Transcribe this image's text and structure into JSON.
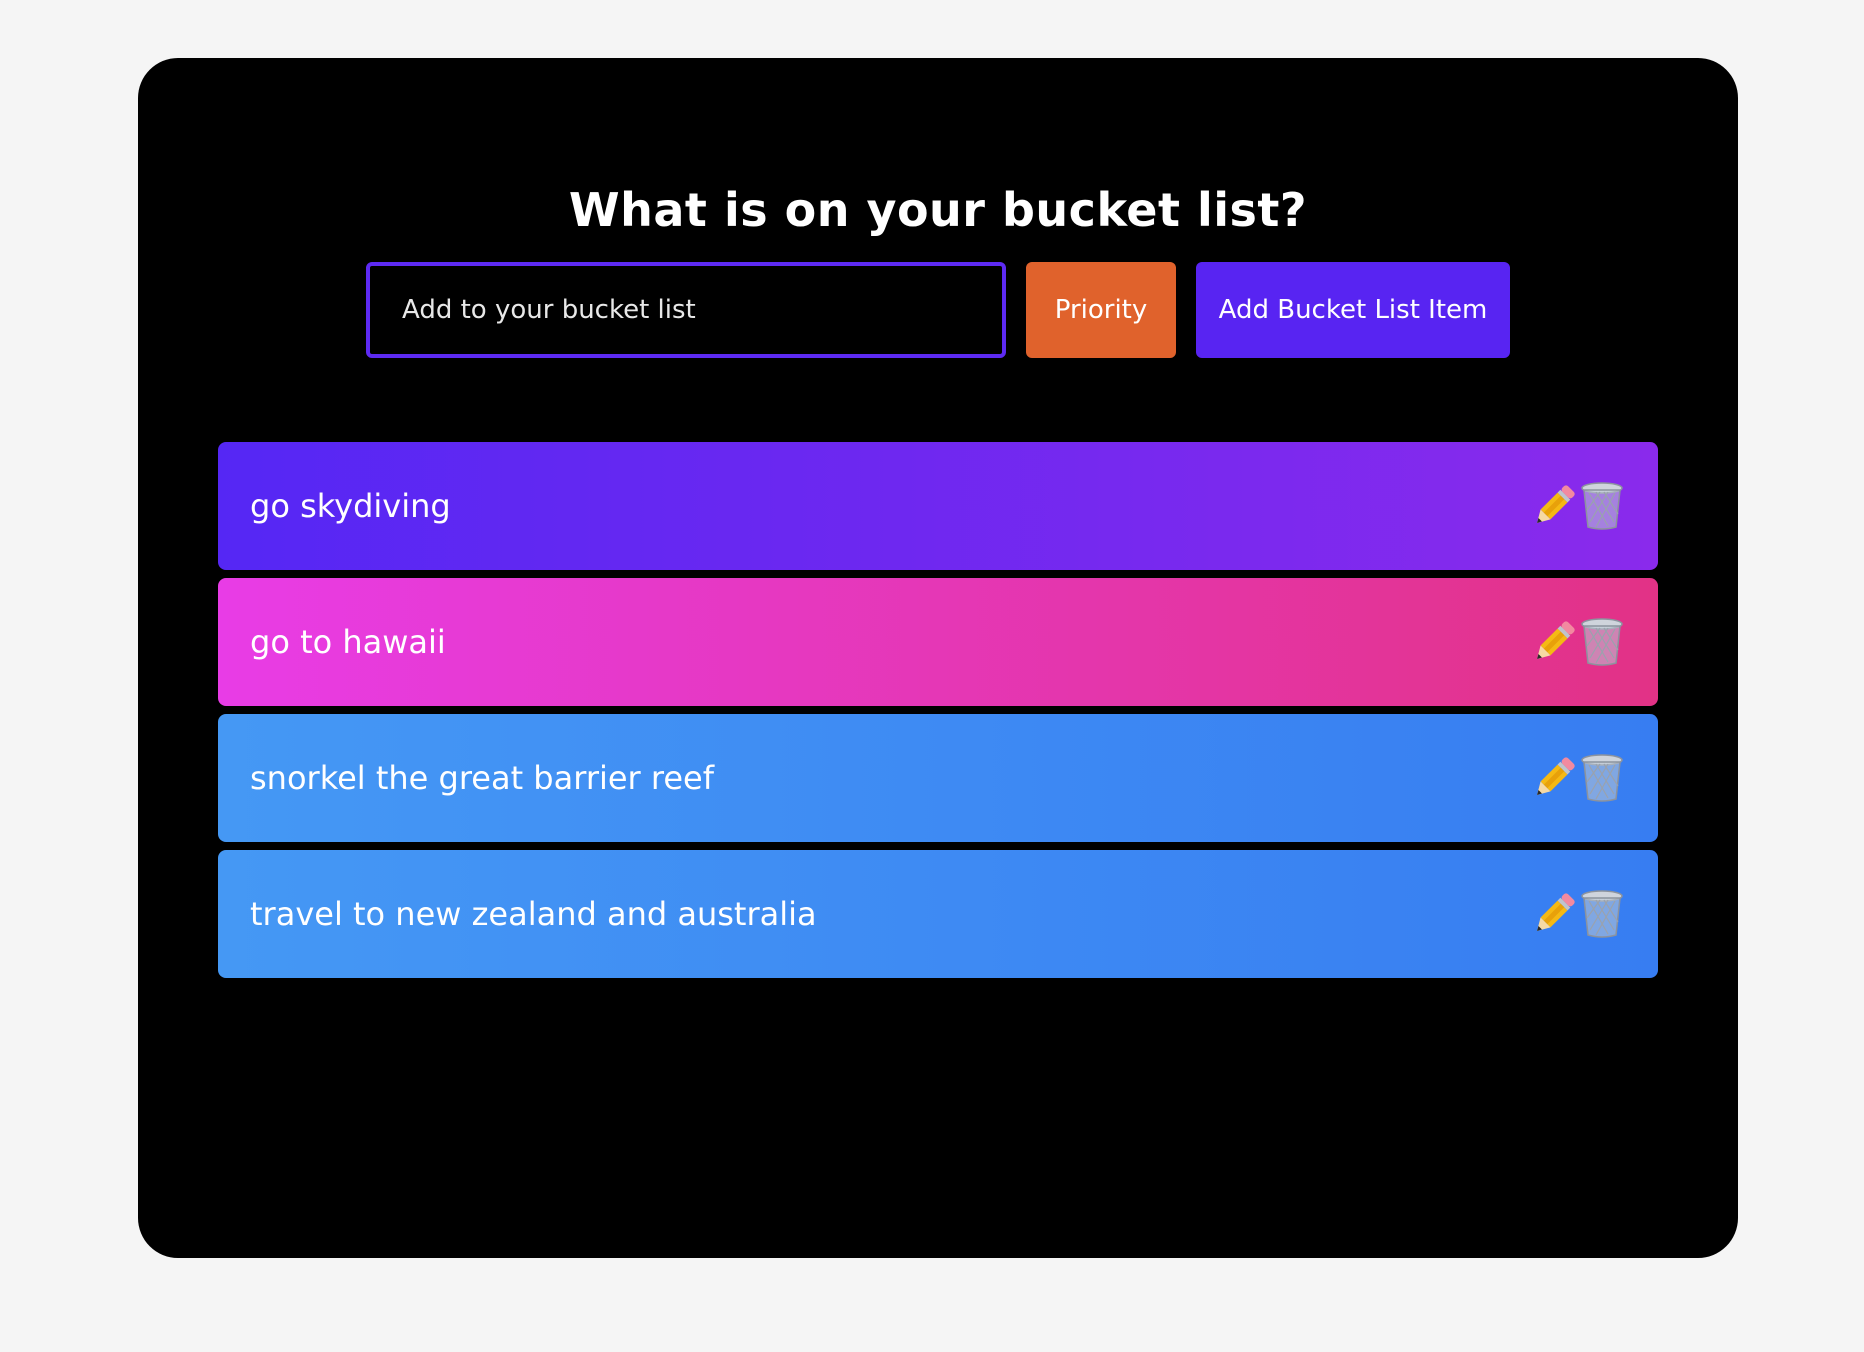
{
  "header": {
    "title": "What is on your bucket list?"
  },
  "form": {
    "input_placeholder": "Add to your bucket list",
    "input_value": "",
    "priority_label": "Priority",
    "add_label": "Add Bucket List Item"
  },
  "colors": {
    "background": "#f5f5f5",
    "card": "#000000",
    "input_border": "#5d2af2",
    "priority_button": "#e0622c",
    "add_button": "#5824f2",
    "row_purple": [
      "#5527f4",
      "#8a2aec"
    ],
    "row_pink": [
      "#e83ce6",
      "#e23286"
    ],
    "row_blue": [
      "#4598f4",
      "#377df2"
    ]
  },
  "items": [
    {
      "text": "go skydiving",
      "color": "purple",
      "edit_icon": "pencil-icon",
      "delete_icon": "wastebasket-icon"
    },
    {
      "text": "go to hawaii",
      "color": "pink",
      "edit_icon": "pencil-icon",
      "delete_icon": "wastebasket-icon"
    },
    {
      "text": "snorkel the great barrier reef",
      "color": "blue",
      "edit_icon": "pencil-icon",
      "delete_icon": "wastebasket-icon"
    },
    {
      "text": "travel to new zealand and australia",
      "color": "blue",
      "edit_icon": "pencil-icon",
      "delete_icon": "wastebasket-icon"
    }
  ]
}
